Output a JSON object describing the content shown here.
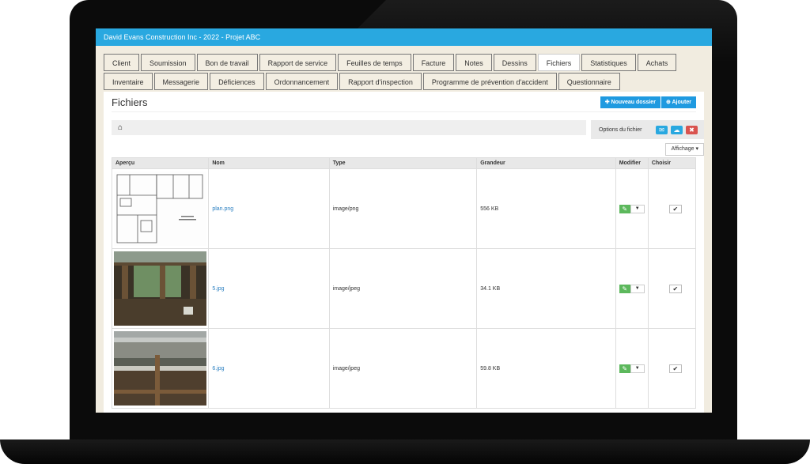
{
  "app": {
    "title": "David Evans Construction Inc - 2022 - Projet ABC"
  },
  "tabs_row1": [
    "Client",
    "Soumission",
    "Bon de travail",
    "Rapport de service",
    "Feuilles de temps",
    "Facture",
    "Notes",
    "Dessins",
    "Fichiers",
    "Statistiques",
    "Achats"
  ],
  "tabs_row2": [
    "Inventaire",
    "Messagerie",
    "Déficiences",
    "Ordonnancement",
    "Rapport d'inspection",
    "Programme de prévention d'accident",
    "Questionnaire"
  ],
  "active_tab": "Fichiers",
  "panel": {
    "title": "Fichiers",
    "new_folder": "Nouveau dossier",
    "add": "Ajouter",
    "home_icon": "home-icon"
  },
  "file_options": {
    "label": "Options du fichier",
    "icons": [
      "envelope-icon",
      "cloud-icon",
      "trash-icon"
    ]
  },
  "affichage": "Affichage",
  "table": {
    "headers": [
      "Aperçu",
      "Nom",
      "Type",
      "Grandeur",
      "Modifier",
      "Choisir"
    ],
    "rows": [
      {
        "name": "plan.png",
        "type": "image/png",
        "size": "556 KB"
      },
      {
        "name": "5.jpg",
        "type": "image/jpeg",
        "size": "34.1 KB"
      },
      {
        "name": "6.jpg",
        "type": "image/jpeg",
        "size": "59.8 KB"
      }
    ]
  },
  "colors": {
    "header": "#29a8e0",
    "edit": "#5cb85c",
    "delete": "#d9534f"
  }
}
